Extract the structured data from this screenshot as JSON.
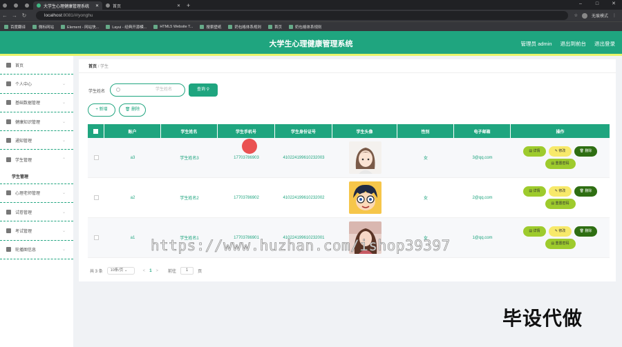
{
  "browser": {
    "tabs": [
      {
        "label": "",
        "icon": "tab-icon",
        "active": false
      },
      {
        "label": "",
        "icon": "github-icon",
        "active": false
      },
      {
        "label": "",
        "icon": "tab-icon",
        "active": false
      },
      {
        "label": "大学生心理健康管理系统",
        "icon": "vue-icon",
        "active": true
      },
      {
        "label": "首页",
        "icon": "globe-icon",
        "active": false
      }
    ],
    "url_host": "localhost",
    "url_rest": ":8081/#/yonghu",
    "profile_label": "无痕模式",
    "bookmarks": [
      "百度翻译",
      "微标网站",
      "Element - 网站快...",
      "Layui - 经典开源模...",
      "HTML5 Website T...",
      "搜索壁纸",
      "奶包格体系规则",
      "首页",
      "奶包格体系规则"
    ]
  },
  "header": {
    "title": "大学生心理健康管理系统",
    "user_label": "管理员 admin",
    "exit_to_front": "退出到前台",
    "logout": "退出登录"
  },
  "sidebar": {
    "items": [
      {
        "label": "首页",
        "icon": "home-icon",
        "has_chevron": false
      },
      {
        "label": "个人中心",
        "icon": "user-icon",
        "has_chevron": true
      },
      {
        "label": "基础数据管理",
        "icon": "chat-icon",
        "has_chevron": true
      },
      {
        "label": "健康知识管理",
        "icon": "clock-icon",
        "has_chevron": true
      },
      {
        "label": "通知管理",
        "icon": "folder-icon",
        "has_chevron": true
      },
      {
        "label": "学生管理",
        "icon": "grid-icon",
        "has_chevron": true,
        "expanded": true
      }
    ],
    "sub_item": "学生管理",
    "items2": [
      {
        "label": "心理老师管理",
        "icon": "person-icon",
        "has_chevron": true
      },
      {
        "label": "试卷管理",
        "icon": "folder-icon",
        "has_chevron": true
      },
      {
        "label": "考试管理",
        "icon": "monitor-icon",
        "has_chevron": true
      },
      {
        "label": "轮播图信息",
        "icon": "grid-icon",
        "has_chevron": true
      }
    ]
  },
  "breadcrumb": {
    "home": "首页",
    "sep": "/",
    "current": "学生"
  },
  "search": {
    "label": "学生姓名",
    "placeholder": "学生姓名",
    "button": "查询"
  },
  "actions": {
    "add": "+ 新增",
    "delete": "删除"
  },
  "table": {
    "columns": [
      "账户",
      "学生姓名",
      "学生手机号",
      "学生身份证号",
      "学生头像",
      "性别",
      "电子邮箱",
      "操作"
    ],
    "rows": [
      {
        "account": "a3",
        "name": "学生姓名3",
        "phone": "17703786903",
        "idcard": "410224199610232003",
        "avatar": "anime-girl-avatar",
        "gender": "女",
        "email": "3@qq.com"
      },
      {
        "account": "a2",
        "name": "学生姓名2",
        "phone": "17703786902",
        "idcard": "410224199610232002",
        "avatar": "cartoon-boy-avatar",
        "gender": "女",
        "email": "2@qq.com"
      },
      {
        "account": "a1",
        "name": "学生姓名1",
        "phone": "17703786901",
        "idcard": "410224199610232001",
        "avatar": "photo-girl-avatar",
        "gender": "女",
        "email": "1@qq.com"
      }
    ],
    "op_labels": {
      "detail": "详情",
      "edit": "修改",
      "delete": "删除",
      "reset": "重置密码"
    }
  },
  "pagination": {
    "total": "共 3 条",
    "page_size": "10条/页",
    "prev": "<",
    "current": "1",
    "next": ">",
    "goto_label": "前往",
    "goto_value": "1",
    "goto_suffix": "页"
  },
  "overlay": {
    "watermark": "https://www.huzhan.com/ishop39397",
    "corner_text": "毕设代做"
  },
  "colors": {
    "primary": "#1fa57f",
    "stripe": "#e8f46a",
    "detail": "#9ecb2d",
    "edit": "#f7e96a",
    "delete": "#2e6e12"
  }
}
